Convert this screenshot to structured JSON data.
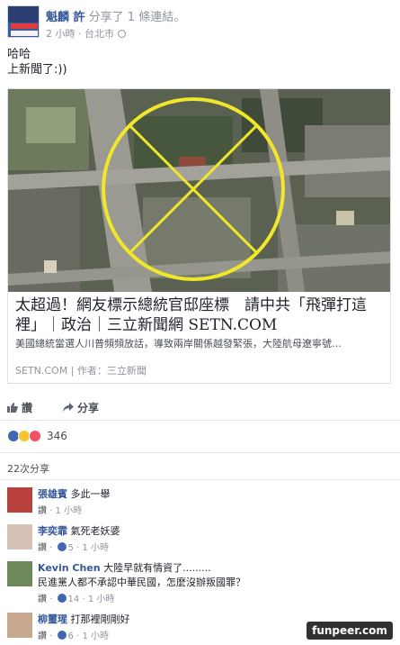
{
  "post": {
    "author": "魁麟 許",
    "action_text": "分享了 1 條連結。",
    "time": "2 小時",
    "location": "台北市",
    "text_line1": "哈哈",
    "text_line2": "上新聞了:))"
  },
  "link_card": {
    "title": "太超過！網友標示總統官邸座標　請中共「飛彈打這裡」｜政治｜三立新聞網 SETN.COM",
    "description": "美國總統當選人川普頻頻放話，導致兩岸關係越發緊張，大陸航母遼寧號…",
    "source": "SETN.COM | 作者：三立新聞"
  },
  "actions": {
    "like_label": "讚",
    "share_label": "分享"
  },
  "reactions": {
    "count": "346"
  },
  "shares": {
    "label": "22次分享"
  },
  "comments": [
    {
      "name": "張雄賓",
      "text": "多此一舉",
      "text2": "",
      "like": "讚",
      "likes": "",
      "time": "1 小時"
    },
    {
      "name": "李奕霏",
      "text": "氣死老妖婆",
      "text2": "",
      "like": "讚",
      "likes": "5",
      "time": "1 小時"
    },
    {
      "name": "Kevin Chen",
      "text": "大陸早就有情資了.........",
      "text2": "民進黨人都不承認中華民國，怎麼沒辦叛國罪？",
      "like": "讚",
      "likes": "14",
      "time": "1 小時"
    },
    {
      "name": "柳璽瑆",
      "text": "打那裡剛剛好",
      "text2": "",
      "like": "讚",
      "likes": "6",
      "time": "1 小時"
    }
  ],
  "watermark": "funpeer.com",
  "colors": {
    "link_blue": "#365899",
    "circle_yellow": "#f0e62a",
    "like_blue": "#4267b2"
  }
}
